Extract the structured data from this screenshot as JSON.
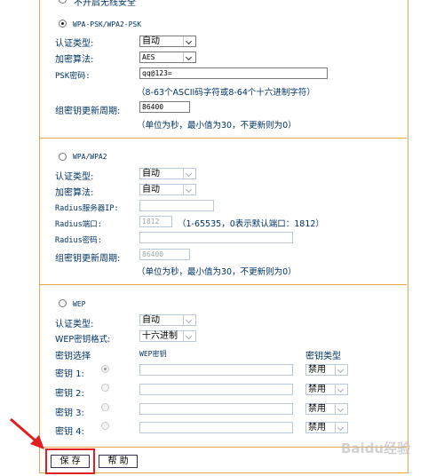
{
  "top_option": "不开启无线安全",
  "wpa_psk": {
    "title": "WPA-PSK/WPA2-PSK",
    "auth_label": "认证类型:",
    "auth_value": "自动",
    "enc_label": "加密算法:",
    "enc_value": "AES",
    "psk_label": "PSK密码:",
    "psk_value": "qq@123=",
    "psk_hint": "（8-63个ASCII码字符或8-64个十六进制字符）",
    "renew_label": "组密钥更新周期:",
    "renew_value": "86400",
    "renew_hint": "（单位为秒，最小值为30，不更新则为0）"
  },
  "wpa": {
    "title": "WPA/WPA2",
    "auth_label": "认证类型:",
    "auth_value": "自动",
    "enc_label": "加密算法:",
    "enc_value": "自动",
    "radius_ip_label": "Radius服务器IP:",
    "radius_ip_value": "",
    "radius_port_label": "Radius端口:",
    "radius_port_value": "1812",
    "radius_port_hint": "（1-65535，0表示默认端口：1812）",
    "radius_pwd_label": "Radius密码:",
    "radius_pwd_value": "",
    "renew_label": "组密钥更新周期:",
    "renew_value": "86400",
    "renew_hint": "（单位为秒，最小值为30，不更新则为0）"
  },
  "wep": {
    "title": "WEP",
    "auth_label": "认证类型:",
    "auth_value": "自动",
    "format_label": "WEP密钥格式:",
    "format_value": "十六进制",
    "col_select": "密钥选择",
    "col_key": "WEP密钥",
    "col_type": "密钥类型",
    "keys": [
      {
        "label": "密钥 1:",
        "value": "",
        "type": "禁用"
      },
      {
        "label": "密钥 2:",
        "value": "",
        "type": "禁用"
      },
      {
        "label": "密钥 3:",
        "value": "",
        "type": "禁用"
      },
      {
        "label": "密钥 4:",
        "value": "",
        "type": "禁用"
      }
    ]
  },
  "buttons": {
    "save": "保 存",
    "help": "帮 助"
  },
  "watermark": "Baidu经验",
  "colors": {
    "frame": "#e8a44c",
    "highlight": "#e02020",
    "text": "#003366"
  }
}
